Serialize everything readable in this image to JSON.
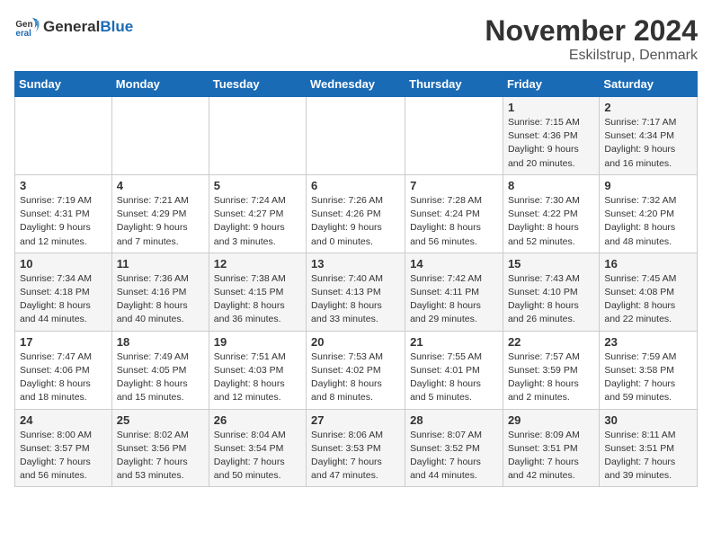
{
  "logo": {
    "general": "General",
    "blue": "Blue"
  },
  "title": "November 2024",
  "subtitle": "Eskilstrup, Denmark",
  "weekdays": [
    "Sunday",
    "Monday",
    "Tuesday",
    "Wednesday",
    "Thursday",
    "Friday",
    "Saturday"
  ],
  "weeks": [
    [
      {
        "day": "",
        "info": ""
      },
      {
        "day": "",
        "info": ""
      },
      {
        "day": "",
        "info": ""
      },
      {
        "day": "",
        "info": ""
      },
      {
        "day": "",
        "info": ""
      },
      {
        "day": "1",
        "info": "Sunrise: 7:15 AM\nSunset: 4:36 PM\nDaylight: 9 hours and 20 minutes."
      },
      {
        "day": "2",
        "info": "Sunrise: 7:17 AM\nSunset: 4:34 PM\nDaylight: 9 hours and 16 minutes."
      }
    ],
    [
      {
        "day": "3",
        "info": "Sunrise: 7:19 AM\nSunset: 4:31 PM\nDaylight: 9 hours and 12 minutes."
      },
      {
        "day": "4",
        "info": "Sunrise: 7:21 AM\nSunset: 4:29 PM\nDaylight: 9 hours and 7 minutes."
      },
      {
        "day": "5",
        "info": "Sunrise: 7:24 AM\nSunset: 4:27 PM\nDaylight: 9 hours and 3 minutes."
      },
      {
        "day": "6",
        "info": "Sunrise: 7:26 AM\nSunset: 4:26 PM\nDaylight: 9 hours and 0 minutes."
      },
      {
        "day": "7",
        "info": "Sunrise: 7:28 AM\nSunset: 4:24 PM\nDaylight: 8 hours and 56 minutes."
      },
      {
        "day": "8",
        "info": "Sunrise: 7:30 AM\nSunset: 4:22 PM\nDaylight: 8 hours and 52 minutes."
      },
      {
        "day": "9",
        "info": "Sunrise: 7:32 AM\nSunset: 4:20 PM\nDaylight: 8 hours and 48 minutes."
      }
    ],
    [
      {
        "day": "10",
        "info": "Sunrise: 7:34 AM\nSunset: 4:18 PM\nDaylight: 8 hours and 44 minutes."
      },
      {
        "day": "11",
        "info": "Sunrise: 7:36 AM\nSunset: 4:16 PM\nDaylight: 8 hours and 40 minutes."
      },
      {
        "day": "12",
        "info": "Sunrise: 7:38 AM\nSunset: 4:15 PM\nDaylight: 8 hours and 36 minutes."
      },
      {
        "day": "13",
        "info": "Sunrise: 7:40 AM\nSunset: 4:13 PM\nDaylight: 8 hours and 33 minutes."
      },
      {
        "day": "14",
        "info": "Sunrise: 7:42 AM\nSunset: 4:11 PM\nDaylight: 8 hours and 29 minutes."
      },
      {
        "day": "15",
        "info": "Sunrise: 7:43 AM\nSunset: 4:10 PM\nDaylight: 8 hours and 26 minutes."
      },
      {
        "day": "16",
        "info": "Sunrise: 7:45 AM\nSunset: 4:08 PM\nDaylight: 8 hours and 22 minutes."
      }
    ],
    [
      {
        "day": "17",
        "info": "Sunrise: 7:47 AM\nSunset: 4:06 PM\nDaylight: 8 hours and 18 minutes."
      },
      {
        "day": "18",
        "info": "Sunrise: 7:49 AM\nSunset: 4:05 PM\nDaylight: 8 hours and 15 minutes."
      },
      {
        "day": "19",
        "info": "Sunrise: 7:51 AM\nSunset: 4:03 PM\nDaylight: 8 hours and 12 minutes."
      },
      {
        "day": "20",
        "info": "Sunrise: 7:53 AM\nSunset: 4:02 PM\nDaylight: 8 hours and 8 minutes."
      },
      {
        "day": "21",
        "info": "Sunrise: 7:55 AM\nSunset: 4:01 PM\nDaylight: 8 hours and 5 minutes."
      },
      {
        "day": "22",
        "info": "Sunrise: 7:57 AM\nSunset: 3:59 PM\nDaylight: 8 hours and 2 minutes."
      },
      {
        "day": "23",
        "info": "Sunrise: 7:59 AM\nSunset: 3:58 PM\nDaylight: 7 hours and 59 minutes."
      }
    ],
    [
      {
        "day": "24",
        "info": "Sunrise: 8:00 AM\nSunset: 3:57 PM\nDaylight: 7 hours and 56 minutes."
      },
      {
        "day": "25",
        "info": "Sunrise: 8:02 AM\nSunset: 3:56 PM\nDaylight: 7 hours and 53 minutes."
      },
      {
        "day": "26",
        "info": "Sunrise: 8:04 AM\nSunset: 3:54 PM\nDaylight: 7 hours and 50 minutes."
      },
      {
        "day": "27",
        "info": "Sunrise: 8:06 AM\nSunset: 3:53 PM\nDaylight: 7 hours and 47 minutes."
      },
      {
        "day": "28",
        "info": "Sunrise: 8:07 AM\nSunset: 3:52 PM\nDaylight: 7 hours and 44 minutes."
      },
      {
        "day": "29",
        "info": "Sunrise: 8:09 AM\nSunset: 3:51 PM\nDaylight: 7 hours and 42 minutes."
      },
      {
        "day": "30",
        "info": "Sunrise: 8:11 AM\nSunset: 3:51 PM\nDaylight: 7 hours and 39 minutes."
      }
    ]
  ]
}
